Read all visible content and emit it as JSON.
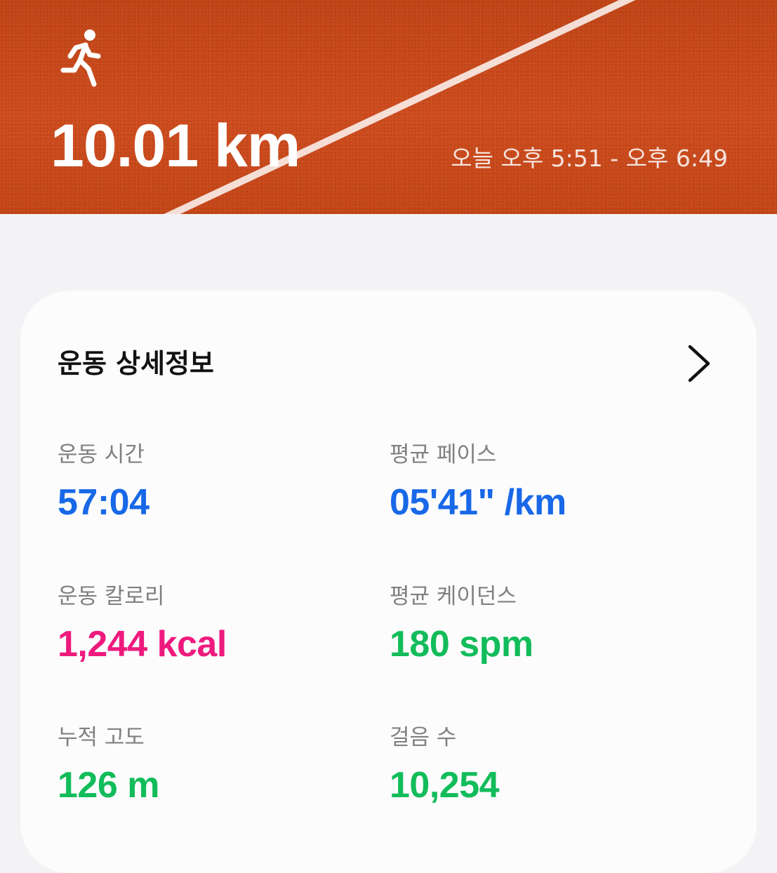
{
  "header": {
    "activity_icon": "running-person-icon",
    "distance": "10.01 km",
    "time_range": "오늘 오후 5:51 - 오후 6:49"
  },
  "card": {
    "title": "운동 상세정보",
    "chevron_icon": "chevron-right-icon",
    "stats": [
      {
        "label": "운동 시간",
        "value": "57:04",
        "color": "#1868e8"
      },
      {
        "label": "평균 페이스",
        "value": "05'41\" /km",
        "color": "#1868e8"
      },
      {
        "label": "운동 칼로리",
        "value": "1,244 kcal",
        "color": "#ee1a7e"
      },
      {
        "label": "평균 케이던스",
        "value": "180 spm",
        "color": "#12bc5a"
      },
      {
        "label": "누적 고도",
        "value": "126 m",
        "color": "#12bc5a"
      },
      {
        "label": "걸음 수",
        "value": "10,254",
        "color": "#12bc5a"
      }
    ]
  },
  "colors": {
    "track": "#c9461c",
    "card_background": "#fcfcfd",
    "page_background": "#f3f3f5"
  }
}
